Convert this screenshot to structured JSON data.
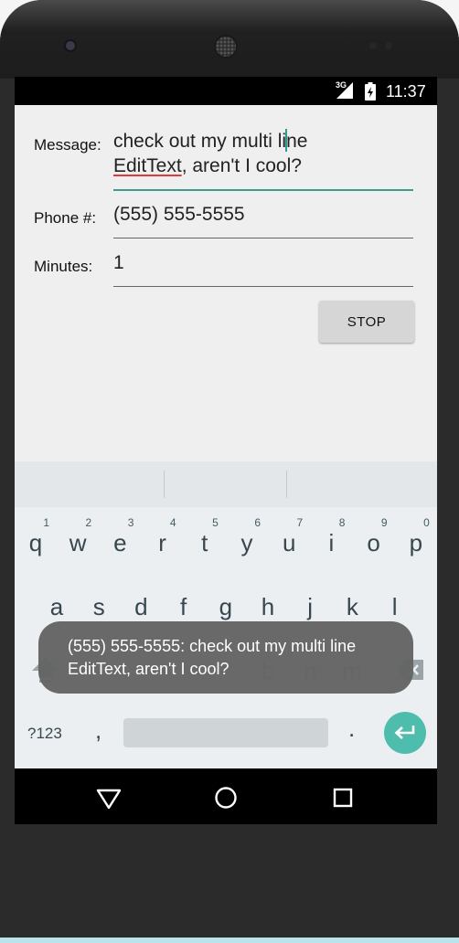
{
  "status_bar": {
    "network": "3G",
    "time": "11:37"
  },
  "form": {
    "message_label": "Message:",
    "message_line1_before_cursor": "check out my multi li",
    "message_line1_after_cursor": "ne",
    "message_line2_misspelled": "EditText",
    "message_line2_rest": ", aren't I cool?",
    "phone_label": "Phone #:",
    "phone_value": "(555) 555-5555",
    "minutes_label": "Minutes:",
    "minutes_value": "1",
    "stop_button": "STOP"
  },
  "keyboard": {
    "row1": [
      {
        "key": "q",
        "hint": "1"
      },
      {
        "key": "w",
        "hint": "2"
      },
      {
        "key": "e",
        "hint": "3"
      },
      {
        "key": "r",
        "hint": "4"
      },
      {
        "key": "t",
        "hint": "5"
      },
      {
        "key": "y",
        "hint": "6"
      },
      {
        "key": "u",
        "hint": "7"
      },
      {
        "key": "i",
        "hint": "8"
      },
      {
        "key": "o",
        "hint": "9"
      },
      {
        "key": "p",
        "hint": "0"
      }
    ],
    "row2": [
      "a",
      "s",
      "d",
      "f",
      "g",
      "h",
      "j",
      "k",
      "l"
    ],
    "row3_visible": [
      "b",
      "n",
      "m"
    ],
    "symbols_key": "?123",
    "comma_key": ",",
    "period_key": "."
  },
  "toast": {
    "line1": "(555) 555-5555: check out my multi line",
    "line2": "EditText, aren't I cool?"
  },
  "colors": {
    "accent": "#3f9a8c",
    "enter_key": "#4ebdae",
    "spellcheck_underline": "#e53935",
    "app_background": "#efefef",
    "keyboard_background": "#eceff1"
  },
  "icons": [
    "shift-icon",
    "backspace-icon",
    "enter-icon",
    "back-icon",
    "home-icon",
    "recents-icon",
    "signal-icon",
    "battery-icon"
  ]
}
